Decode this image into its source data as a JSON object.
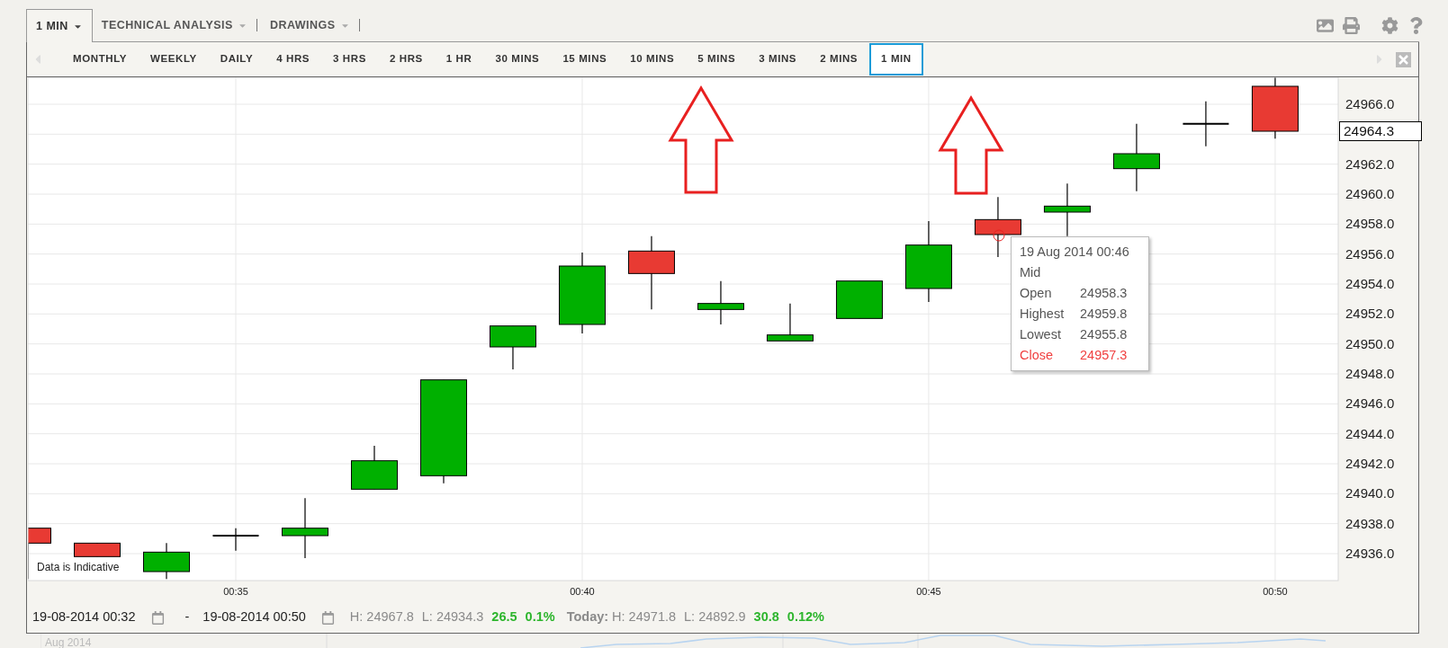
{
  "top_tabs": [
    {
      "label": "1 MIN",
      "selected": true,
      "divider": false
    },
    {
      "label": "TECHNICAL ANALYSIS",
      "selected": false,
      "divider": true
    },
    {
      "label": "DRAWINGS",
      "selected": false,
      "divider": true
    }
  ],
  "intervals": [
    {
      "label": "MONTHLY",
      "selected": false
    },
    {
      "label": "WEEKLY",
      "selected": false
    },
    {
      "label": "DAILY",
      "selected": false
    },
    {
      "label": "4 HRS",
      "selected": false
    },
    {
      "label": "3 HRS",
      "selected": false
    },
    {
      "label": "2 HRS",
      "selected": false
    },
    {
      "label": "1 HR",
      "selected": false
    },
    {
      "label": "30 MINS",
      "selected": false
    },
    {
      "label": "15 MINS",
      "selected": false
    },
    {
      "label": "10 MINS",
      "selected": false
    },
    {
      "label": "5 MINS",
      "selected": false
    },
    {
      "label": "3 MINS",
      "selected": false
    },
    {
      "label": "2 MINS",
      "selected": false
    },
    {
      "label": "1 MIN",
      "selected": true
    }
  ],
  "chart": {
    "price_label": "24964.3",
    "note": "Data is Indicative",
    "chart_data": {
      "type": "candlestick",
      "xlim": [
        32,
        50.91
      ],
      "ylim": [
        24934.2,
        24967.8
      ],
      "grid": true,
      "xticks": [
        {
          "value": 35,
          "label": "00:35"
        },
        {
          "value": 40,
          "label": "00:40"
        },
        {
          "value": 45,
          "label": "00:45"
        },
        {
          "value": 50,
          "label": "00:50"
        }
      ],
      "yticks": [
        {
          "value": 24936,
          "label": "24936.0"
        },
        {
          "value": 24938,
          "label": "24938.0"
        },
        {
          "value": 24940,
          "label": "24940.0"
        },
        {
          "value": 24942,
          "label": "24942.0"
        },
        {
          "value": 24944,
          "label": "24944.0"
        },
        {
          "value": 24946,
          "label": "24946.0"
        },
        {
          "value": 24948,
          "label": "24948.0"
        },
        {
          "value": 24950,
          "label": "24950.0"
        },
        {
          "value": 24952,
          "label": "24952.0"
        },
        {
          "value": 24954,
          "label": "24954.0"
        },
        {
          "value": 24956,
          "label": "24956.0"
        },
        {
          "value": 24958,
          "label": "24958.0"
        },
        {
          "value": 24960,
          "label": "24960.0"
        },
        {
          "value": 24962,
          "label": "24962.0"
        },
        {
          "value": 24966,
          "label": "24966.0"
        }
      ]
    },
    "tooltip": {
      "date": "19 Aug 2014 00:46",
      "subtitle": "Mid",
      "rows": [
        {
          "label": "Open",
          "value": "24958.3",
          "color": "#555555"
        },
        {
          "label": "Highest",
          "value": "24959.8",
          "color": "#555555"
        },
        {
          "label": "Lowest",
          "value": "24955.8",
          "color": "#555555"
        },
        {
          "label": "Close",
          "value": "24957.3",
          "color": "#f04040"
        }
      ]
    }
  },
  "footer": {
    "from": "19-08-2014 00:32",
    "separator": "-",
    "to": "19-08-2014 00:50",
    "stats": [
      {
        "text": "H: 24967.8",
        "kind": "plain"
      },
      {
        "text": "L: 24934.3",
        "kind": "plain"
      },
      {
        "text": "26.5",
        "kind": "up"
      },
      {
        "text": "0.1%",
        "kind": "up"
      }
    ],
    "today_label": "Today:",
    "today_stats": [
      {
        "text": "H: 24971.8",
        "kind": "plain"
      },
      {
        "text": "L: 24892.9",
        "kind": "plain"
      },
      {
        "text": "30.8",
        "kind": "up"
      },
      {
        "text": "0.12%",
        "kind": "up"
      }
    ]
  },
  "navigator": {
    "label": "Aug 2014"
  }
}
